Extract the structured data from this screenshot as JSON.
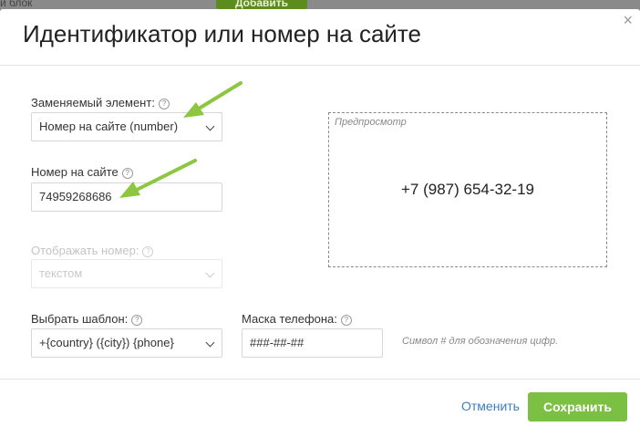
{
  "background": {
    "label": "й блок",
    "button": "Добавить"
  },
  "modal": {
    "title": "Идентификатор или номер на сайте",
    "close_symbol": "×"
  },
  "fields": {
    "element": {
      "label": "Заменяемый элемент:",
      "value": "Номер на сайте (number)"
    },
    "number": {
      "label": "Номер на сайте",
      "value": "74959268686"
    },
    "display": {
      "label": "Отображать номер:",
      "value": "текстом"
    },
    "template": {
      "label": "Выбрать шаблон:",
      "value": "+{country} ({city}) {phone}"
    },
    "mask": {
      "label": "Маска телефона:",
      "value": "###-##-##"
    },
    "help_symbol": "?"
  },
  "preview": {
    "label": "Предпросмотр",
    "number": "+7 (987) 654-32-19"
  },
  "hint": "Символ # для обозначения цифр.",
  "footer": {
    "cancel": "Отменить",
    "save": "Сохранить"
  },
  "colors": {
    "accent_green": "#7bc043",
    "link_blue": "#3b7ec2",
    "annotation_arrow": "#8dc63f"
  },
  "icons": {
    "close": "close-icon",
    "help": "help-icon",
    "dropdown": "chevron-down-icon",
    "annotation": "arrow-annotation"
  }
}
